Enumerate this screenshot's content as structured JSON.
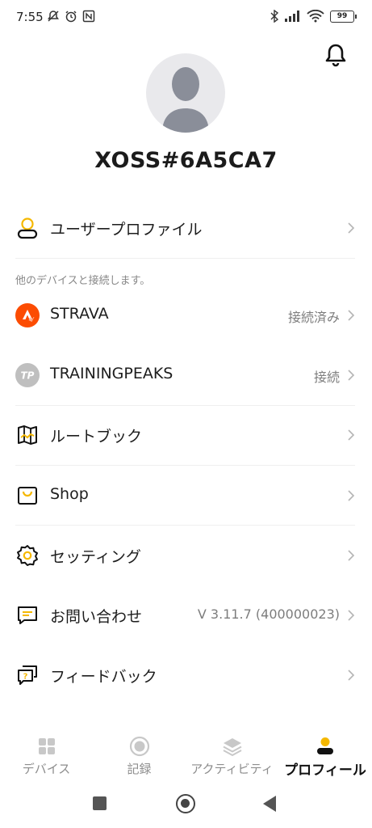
{
  "status_bar": {
    "time": "7:55",
    "battery": "99"
  },
  "profile": {
    "username": "XOSS#6A5CA7"
  },
  "menu": {
    "user_profile": "ユーザープロファイル",
    "section_note": "他のデバイスと接続します。",
    "strava": {
      "label": "STRAVA",
      "status": "接続済み"
    },
    "trainingpeaks": {
      "label": "TRAININGPEAKS",
      "status": "接続"
    },
    "routebook": "ルートブック",
    "shop": "Shop",
    "settings": "セッティング",
    "contact": {
      "label": "お問い合わせ",
      "version": "V 3.11.7 (400000023)"
    },
    "feedback": "フィードバック"
  },
  "tabs": [
    {
      "label": "デバイス"
    },
    {
      "label": "記録"
    },
    {
      "label": "アクティビティ"
    },
    {
      "label": "プロフィール"
    }
  ],
  "colors": {
    "accent": "#f5b800",
    "strava": "#fc4c02",
    "tp_gray": "#bfbfbf"
  }
}
